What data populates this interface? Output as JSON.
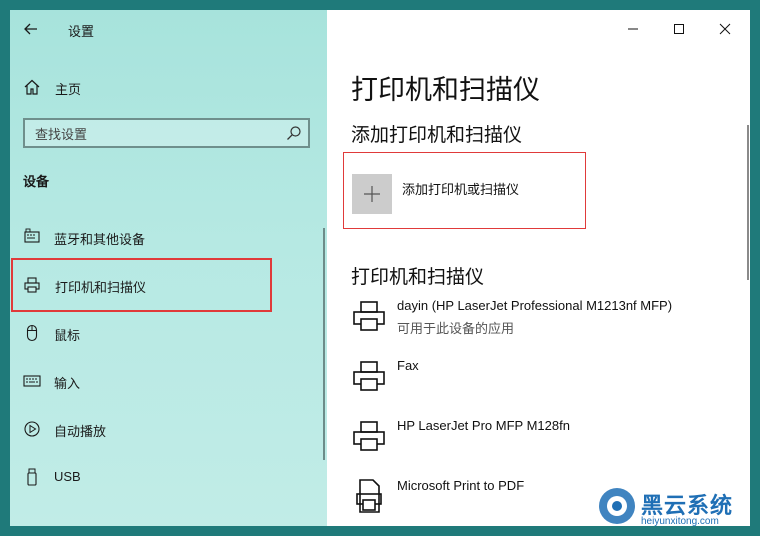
{
  "app": {
    "title": "设置"
  },
  "sidebar": {
    "home_label": "主页",
    "search_placeholder": "查找设置",
    "section_header": "设备",
    "items": [
      {
        "label": "蓝牙和其他设备",
        "icon": "bluetooth-devices-icon"
      },
      {
        "label": "打印机和扫描仪",
        "icon": "printer-icon",
        "selected": true
      },
      {
        "label": "鼠标",
        "icon": "mouse-icon"
      },
      {
        "label": "输入",
        "icon": "keyboard-icon"
      },
      {
        "label": "自动播放",
        "icon": "autoplay-icon"
      },
      {
        "label": "USB",
        "icon": "usb-icon"
      }
    ]
  },
  "main": {
    "page_title": "打印机和扫描仪",
    "add_section_title": "添加打印机和扫描仪",
    "add_button_label": "添加打印机或扫描仪",
    "list_section_title": "打印机和扫描仪",
    "printers": [
      {
        "name": "dayin (HP LaserJet Professional M1213nf MFP)",
        "status": "可用于此设备的应用",
        "icon": "printer-icon"
      },
      {
        "name": "Fax",
        "status": "",
        "icon": "printer-icon"
      },
      {
        "name": "HP LaserJet Pro MFP M128fn",
        "status": "",
        "icon": "printer-icon"
      },
      {
        "name": "Microsoft Print to PDF",
        "status": "",
        "icon": "pdf-printer-icon"
      }
    ]
  },
  "watermark": {
    "brand": "黑云系统",
    "url": "heiyunxitong.com"
  },
  "colors": {
    "sidebar_bg": "#a7e3dc",
    "highlight": "#e03a3a",
    "accent": "#1f6fb5"
  }
}
